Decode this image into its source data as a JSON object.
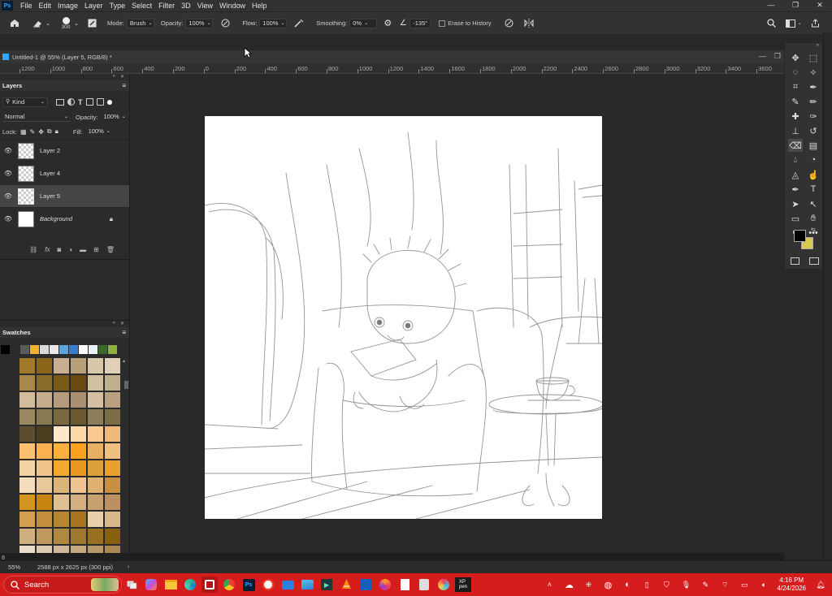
{
  "app": {
    "logo": "Ps",
    "window_controls": [
      "—",
      "❐",
      "✕"
    ]
  },
  "menu": [
    "File",
    "Edit",
    "Image",
    "Layer",
    "Type",
    "Select",
    "Filter",
    "3D",
    "View",
    "Window",
    "Help"
  ],
  "options": {
    "brush_size": "300",
    "mode_label": "Mode:",
    "mode_value": "Brush",
    "opacity_label": "Opacity:",
    "opacity_value": "100%",
    "flow_label": "Flow:",
    "flow_value": "100%",
    "smoothing_label": "Smoothing:",
    "smoothing_value": "0%",
    "angle_value": "-135°",
    "erase_history_label": "Erase to History"
  },
  "document": {
    "tab_title": "Untitled-1 @ 55% (Layer 5, RGB/8) *"
  },
  "ruler": {
    "labels": [
      "1200",
      "1000",
      "800",
      "600",
      "400",
      "200",
      "0",
      "200",
      "400",
      "600",
      "800",
      "1000",
      "1200",
      "1400",
      "1600",
      "1800",
      "2000",
      "2200",
      "2400",
      "2600",
      "2800",
      "3000",
      "3200",
      "3400",
      "3600"
    ]
  },
  "layers_panel": {
    "title": "Layers",
    "filter_kind": "Kind",
    "blend_mode": "Normal",
    "opacity_label": "Opacity:",
    "opacity_value": "100%",
    "lock_label": "Lock:",
    "fill_label": "Fill:",
    "fill_value": "100%",
    "layers": [
      {
        "name": "Layer 2",
        "selected": false,
        "type": "transparent"
      },
      {
        "name": "Layer 4",
        "selected": false,
        "type": "transparent"
      },
      {
        "name": "Layer 5",
        "selected": true,
        "type": "transparent"
      },
      {
        "name": "Background",
        "selected": false,
        "type": "white",
        "locked": true
      }
    ],
    "footer_icons": [
      "link-icon",
      "fx-icon",
      "mask-icon",
      "adjustment-icon",
      "folder-icon",
      "new-layer-icon",
      "trash-icon"
    ]
  },
  "swatches_panel": {
    "title": "Swatches",
    "recent": [
      "#000000",
      "#2a2a2a",
      "#5a5a5a",
      "#f0b030",
      "#d9d9d9",
      "#e8e8e8",
      "#5aa6dc",
      "#3a7ccc",
      "#ffffff",
      "#e8f0f8",
      "#3a6a2a",
      "#8fb040"
    ],
    "grid": [
      "#a07a2a",
      "#8a6418",
      "#c8b090",
      "#b8a078",
      "#d8c8a8",
      "#e0d0b8",
      "#a88848",
      "#8a6a28",
      "#7a5a18",
      "#6a4a10",
      "#d0c0a0",
      "#c0b090",
      "#d2bc9c",
      "#c6ae8c",
      "#b49c7c",
      "#a89070",
      "#d4c0a0",
      "#b8a080",
      "#9a8860",
      "#8a7850",
      "#7a6840",
      "#6a5830",
      "#8c7c58",
      "#7c6c48",
      "#5c4c30",
      "#4c3c20",
      "#fce8c8",
      "#fcd8a8",
      "#f8c890",
      "#f0b878",
      "#fcc070",
      "#fcb050",
      "#fcb040",
      "#fca020",
      "#e8b060",
      "#f0c080",
      "#f4d4a4",
      "#f0c48c",
      "#f4a830",
      "#e89820",
      "#dca038",
      "#e8a030",
      "#f4dcbc",
      "#e8c898",
      "#dcb478",
      "#f0c490",
      "#e0b070",
      "#c89040",
      "#d49420",
      "#c88410",
      "#e0c090",
      "#d4b080",
      "#c8a070",
      "#bc9060",
      "#d4a050",
      "#c49040",
      "#b88430",
      "#a87420",
      "#e8d0a8",
      "#d8b888",
      "#d0b080",
      "#c09860",
      "#b08840",
      "#a07830",
      "#987020",
      "#886010",
      "#e8dcc8",
      "#dccab0",
      "#d0b898",
      "#c4a880",
      "#b89868",
      "#ac8850",
      "#8c6010",
      "#7c5008",
      "#ffe0c0",
      "#fcd0a8",
      "#fcc898",
      "#fcc080"
    ]
  },
  "tools": [
    "move-tool",
    "marquee-tool",
    "lasso-tool",
    "magic-wand-tool",
    "crop-tool",
    "eyedropper-tool",
    "brush-tool",
    "pencil-tool",
    "healing-tool",
    "mixer-brush-tool",
    "stamp-tool",
    "history-brush-tool",
    "eraser-tool",
    "gradient-tool",
    "blur-tool",
    "dodge-tool",
    "sharpen-tool",
    "smudge-tool",
    "pen-tool",
    "type-tool",
    "path-select-tool",
    "direct-select-tool",
    "shape-tool",
    "hand-tool",
    "zoom-tool",
    "more-tools"
  ],
  "colors": {
    "foreground": "#000000",
    "background": "#d8c850",
    "accent": "#31a8ff"
  },
  "status": {
    "zoom": "55%",
    "doc_info": "2588 px x 2625 px (300 ppi)",
    "page_input": "8"
  },
  "taskbar": {
    "search_label": "Search",
    "time": "4:16 PM",
    "date": "4/24/2026"
  }
}
